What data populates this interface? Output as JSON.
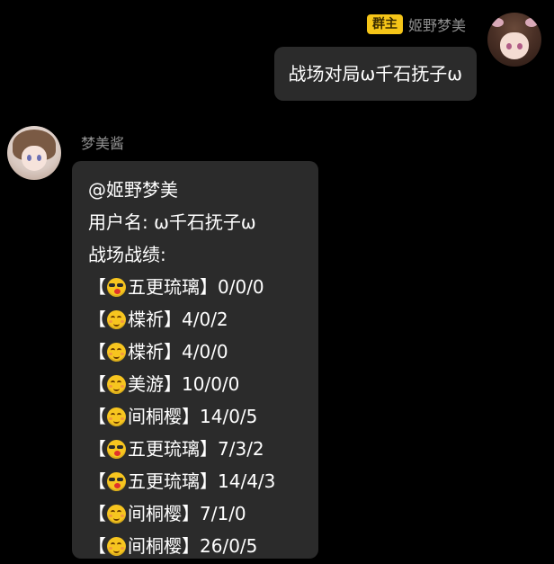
{
  "outgoing": {
    "role_badge": "群主",
    "sender": "姬野梦美",
    "text": "战场对局ω千石抚子ω"
  },
  "incoming": {
    "sender": "梦美酱",
    "mention": "@姬野梦美",
    "username_line": "用户名: ω千石抚子ω",
    "section_title": "战场战绩:",
    "records": [
      {
        "open": "【",
        "emoji": "sunglasses-kiss-emoji",
        "hero": "五更琉璃",
        "close": "】",
        "score": "0/0/0"
      },
      {
        "open": "【",
        "emoji": "smile-emoji",
        "hero": "楪祈",
        "close": "】",
        "score": "4/0/2"
      },
      {
        "open": "【",
        "emoji": "smile-emoji",
        "hero": "楪祈",
        "close": "】",
        "score": "4/0/0"
      },
      {
        "open": "【",
        "emoji": "smile-emoji",
        "hero": "美游",
        "close": "】",
        "score": "10/0/0"
      },
      {
        "open": "【",
        "emoji": "smile-emoji",
        "hero": "间桐樱",
        "close": "】",
        "score": "14/0/5"
      },
      {
        "open": "【",
        "emoji": "sunglasses-kiss-emoji",
        "hero": "五更琉璃",
        "close": "】",
        "score": "7/3/2"
      },
      {
        "open": "【",
        "emoji": "sunglasses-kiss-emoji",
        "hero": "五更琉璃",
        "close": "】",
        "score": "14/4/3"
      },
      {
        "open": "【",
        "emoji": "smile-emoji",
        "hero": "间桐樱",
        "close": "】",
        "score": "7/1/0"
      },
      {
        "open": "【",
        "emoji": "smile-emoji",
        "hero": "间桐樱",
        "close": "】",
        "score": "26/0/5"
      }
    ]
  },
  "colors": {
    "background": "#000000",
    "bubble": "#2b2b2b",
    "badge": "#f5c518",
    "name_text": "#8f8f8f"
  }
}
